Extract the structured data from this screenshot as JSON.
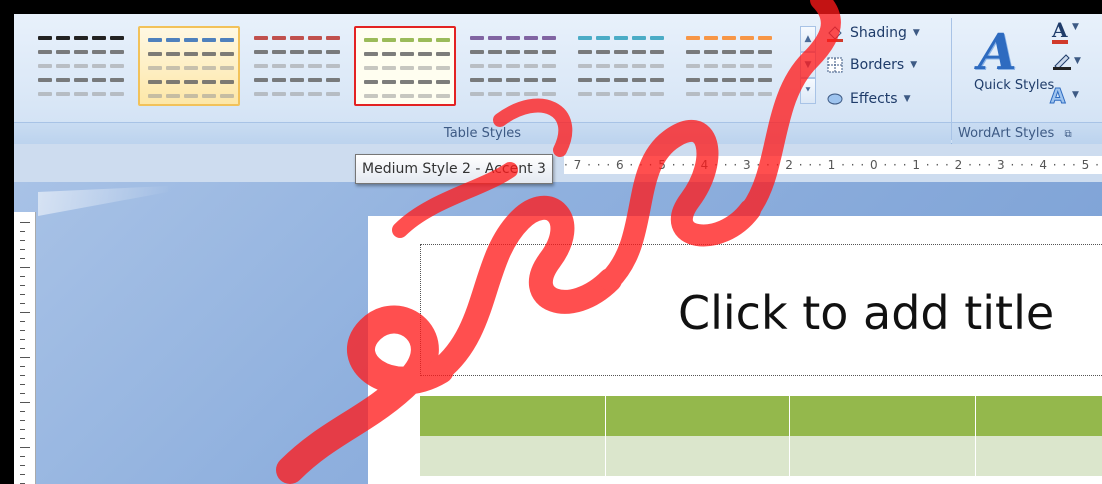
{
  "ribbon": {
    "table_styles_label": "Table Styles",
    "wordart_styles_label": "WordArt Styles",
    "gallery": [
      {
        "name": "style-black",
        "color": "#222222",
        "state": "normal"
      },
      {
        "name": "style-blue",
        "color": "#4f81bd",
        "state": "selected"
      },
      {
        "name": "style-red",
        "color": "#c0504d",
        "state": "normal"
      },
      {
        "name": "style-green",
        "color": "#9bbb59",
        "state": "hover"
      },
      {
        "name": "style-purple",
        "color": "#8064a2",
        "state": "normal"
      },
      {
        "name": "style-teal",
        "color": "#4bacc6",
        "state": "normal"
      },
      {
        "name": "style-orange",
        "color": "#f79646",
        "state": "normal"
      }
    ],
    "commands": {
      "shading": "Shading",
      "borders": "Borders",
      "effects": "Effects"
    },
    "quick_styles": "Quick Styles",
    "wordart_letter": "A"
  },
  "tooltip": "Medium Style 2 - Accent 3",
  "ruler": "· 7 · · · 6 · · · 5 · · · 4 · · · 3 · · · 2 · · · 1 · · · 0 · · · 1 · · · 2 · · · 3 · · · 4 · · · 5 ·",
  "slide": {
    "title_placeholder": "Click to add title"
  },
  "colors": {
    "table_header": "#94b84c",
    "table_body": "#dbe6cc",
    "hover_outline": "#e32222",
    "watermark": "#ff0000"
  }
}
